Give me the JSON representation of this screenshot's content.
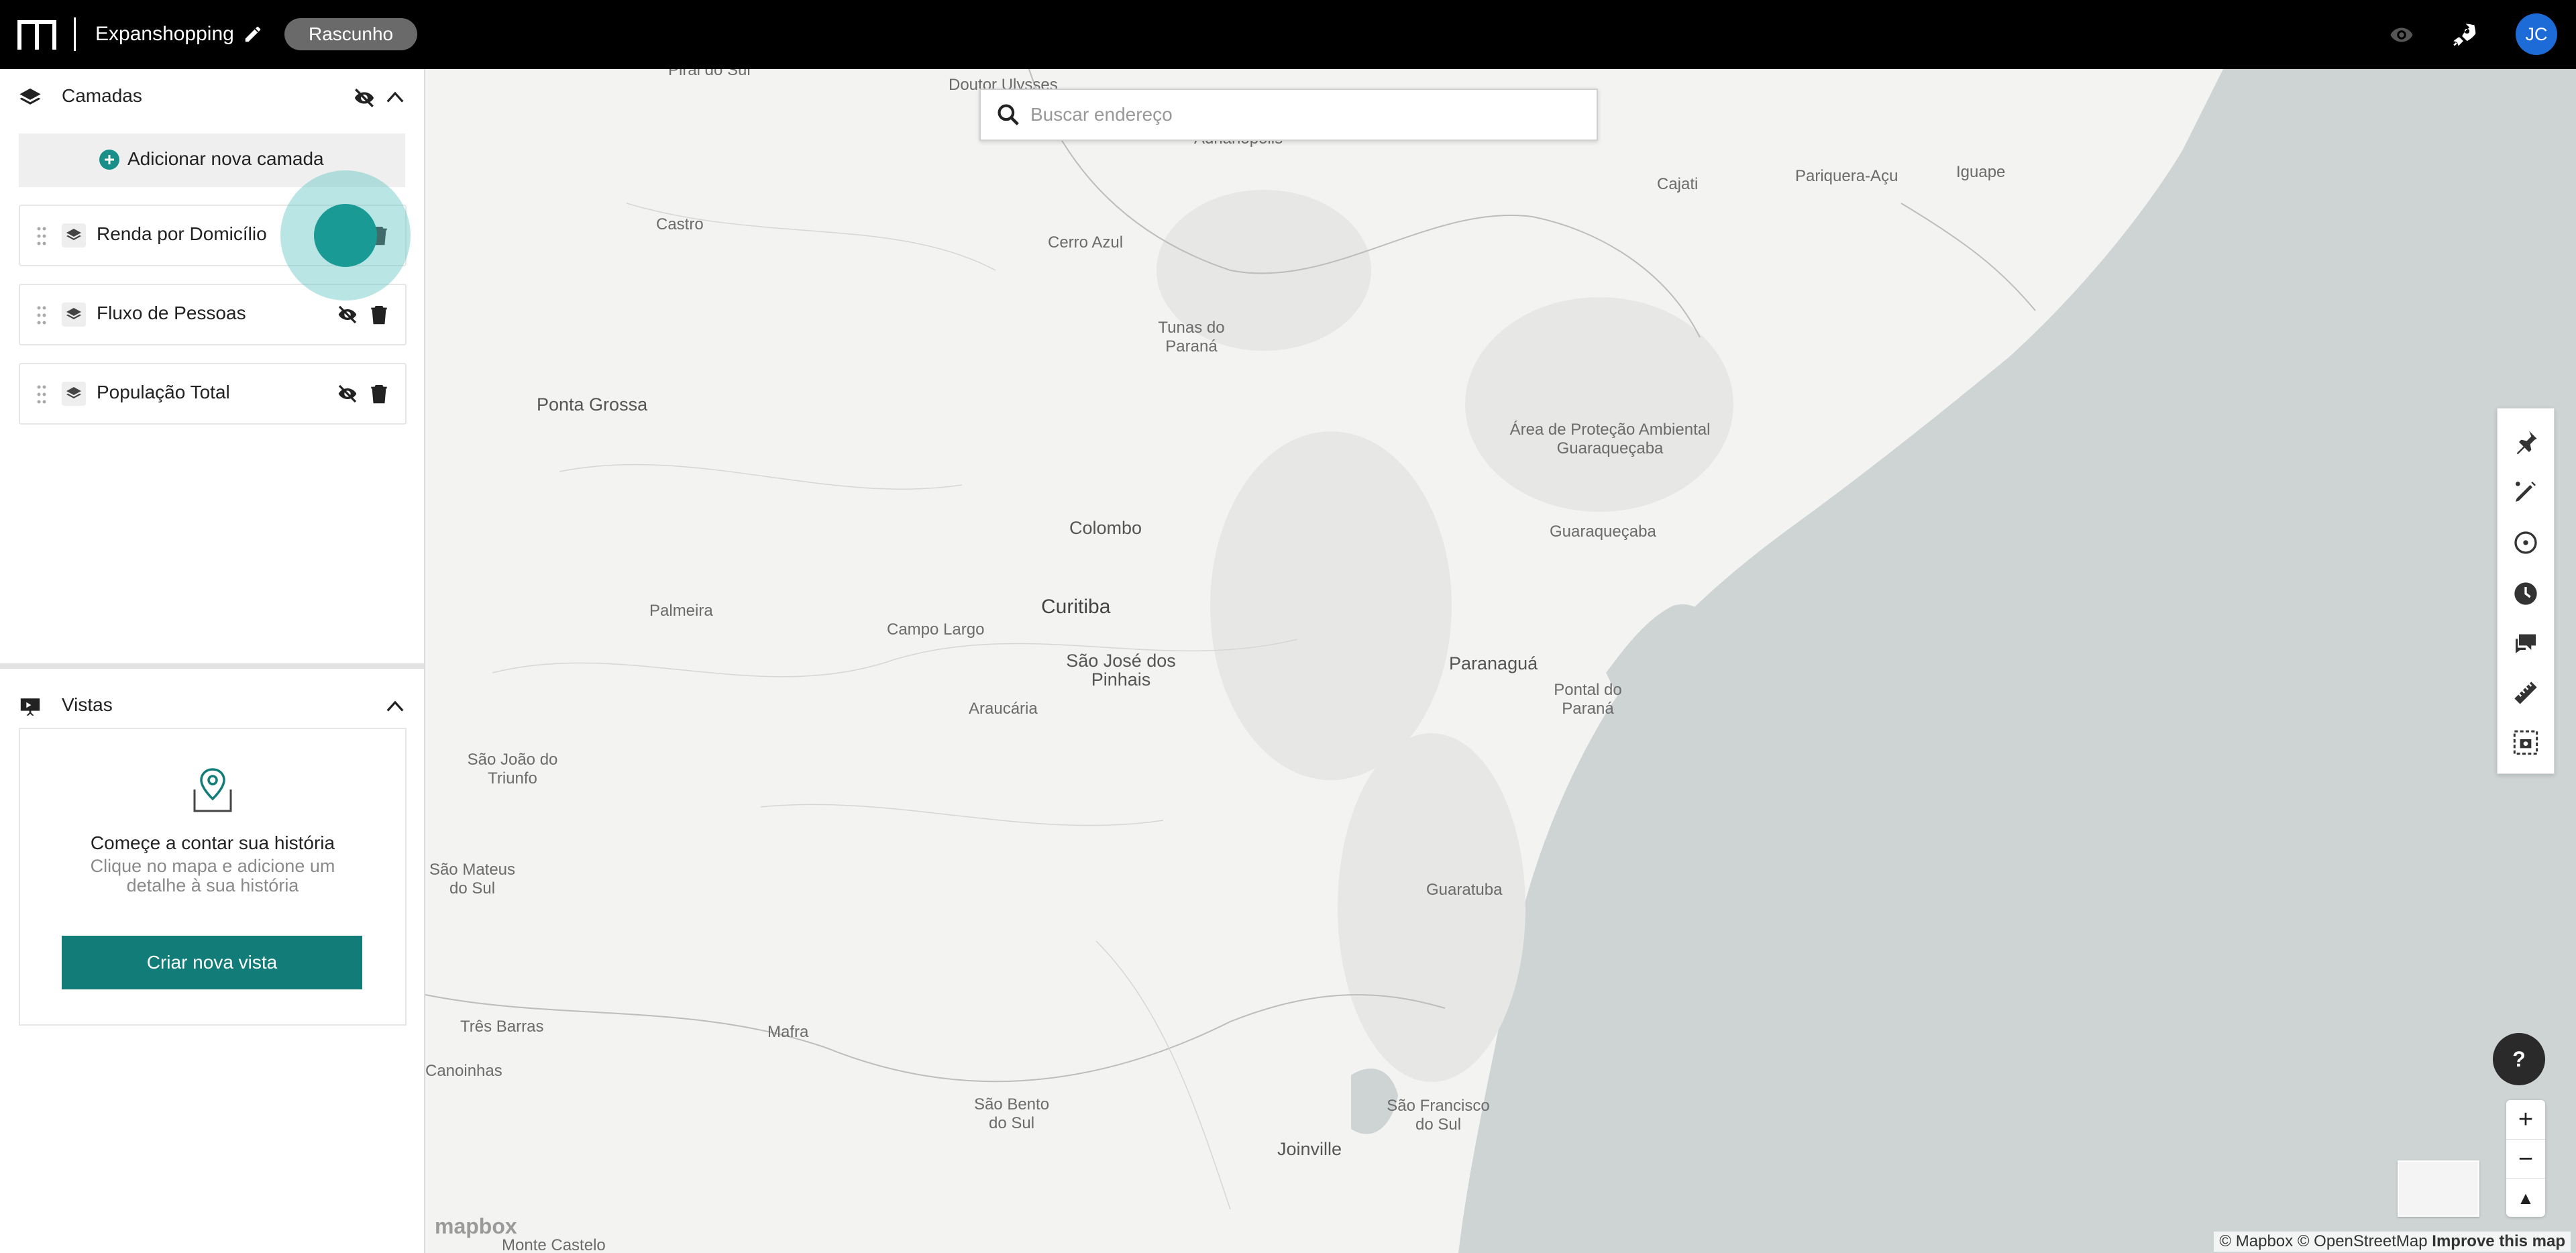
{
  "header": {
    "project_name": "Expanshopping",
    "status_badge": "Rascunho",
    "avatar_initials": "JC"
  },
  "layers_panel": {
    "title": "Camadas",
    "add_label": "Adicionar nova camada",
    "items": [
      {
        "label": "Renda por Domicílio"
      },
      {
        "label": "Fluxo de Pessoas"
      },
      {
        "label": "População Total"
      }
    ]
  },
  "views_panel": {
    "title": "Vistas",
    "empty_title": "Começe a contar sua história",
    "empty_subtitle": "Clique no mapa e adicione um detalhe à sua história",
    "create_button": "Criar nova vista"
  },
  "search": {
    "placeholder": "Buscar endereço"
  },
  "map": {
    "places": [
      {
        "name": "Pirai do Sul"
      },
      {
        "name": "Doutor Ulysses"
      },
      {
        "name": "Adrianópolis"
      },
      {
        "name": "Castro"
      },
      {
        "name": "Cerro Azul"
      },
      {
        "name": "Cajati"
      },
      {
        "name": "Pariquera-Açu"
      },
      {
        "name": "Iguape"
      },
      {
        "name": "Tunas do Paraná"
      },
      {
        "name": "Ponta Grossa"
      },
      {
        "name": "Área de Proteção Ambiental Guaraqueçaba"
      },
      {
        "name": "Guaraqueçaba"
      },
      {
        "name": "Colombo"
      },
      {
        "name": "Curitiba"
      },
      {
        "name": "Campo Largo"
      },
      {
        "name": "Palmeira"
      },
      {
        "name": "São José dos Pinhais"
      },
      {
        "name": "Paranaguá"
      },
      {
        "name": "Araucária"
      },
      {
        "name": "Pontal do Paraná"
      },
      {
        "name": "São João do Triunfo"
      },
      {
        "name": "São Mateus do Sul"
      },
      {
        "name": "Guaratuba"
      },
      {
        "name": "Três Barras"
      },
      {
        "name": "Mafra"
      },
      {
        "name": "Canoinhas"
      },
      {
        "name": "São Bento do Sul"
      },
      {
        "name": "São Francisco do Sul"
      },
      {
        "name": "Joinville"
      },
      {
        "name": "Monte Castelo"
      }
    ],
    "help_label": "?",
    "zoom_in": "+",
    "zoom_out": "−",
    "compass": "▲",
    "mapbox_logo": "mapbox",
    "attribution": "© Mapbox © OpenStreetMap",
    "improve_link": "Improve this map"
  },
  "tools": [
    "pin-icon",
    "draw-icon",
    "radius-icon",
    "isochrone-icon",
    "comment-icon",
    "ruler-icon",
    "screenshot-icon"
  ],
  "colors": {
    "accent": "#117c78",
    "avatar": "#1c6bd6",
    "sea": "#ced3d3"
  }
}
